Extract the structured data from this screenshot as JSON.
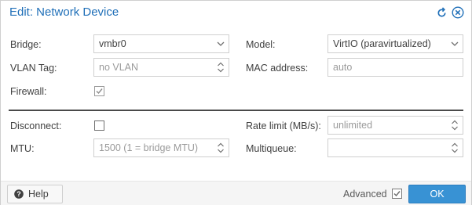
{
  "window": {
    "title": "Edit: Network Device",
    "title_color": "#1f6fb8"
  },
  "form": {
    "bridge": {
      "label": "Bridge:",
      "value": "vmbr0"
    },
    "vlan_tag": {
      "label": "VLAN Tag:",
      "placeholder": "no VLAN"
    },
    "firewall": {
      "label": "Firewall:",
      "checked": true
    },
    "model": {
      "label": "Model:",
      "value": "VirtIO (paravirtualized)"
    },
    "mac_address": {
      "label": "MAC address:",
      "placeholder": "auto"
    },
    "disconnect": {
      "label": "Disconnect:",
      "checked": false
    },
    "mtu": {
      "label": "MTU:",
      "placeholder": "1500 (1 = bridge MTU)"
    },
    "rate_limit": {
      "label": "Rate limit (MB/s):",
      "placeholder": "unlimited"
    },
    "multiqueue": {
      "label": "Multiqueue:",
      "value": ""
    }
  },
  "footer": {
    "help_label": "Help",
    "advanced_label": "Advanced",
    "advanced_checked": true,
    "ok_label": "OK",
    "accent": "#3892d4"
  }
}
